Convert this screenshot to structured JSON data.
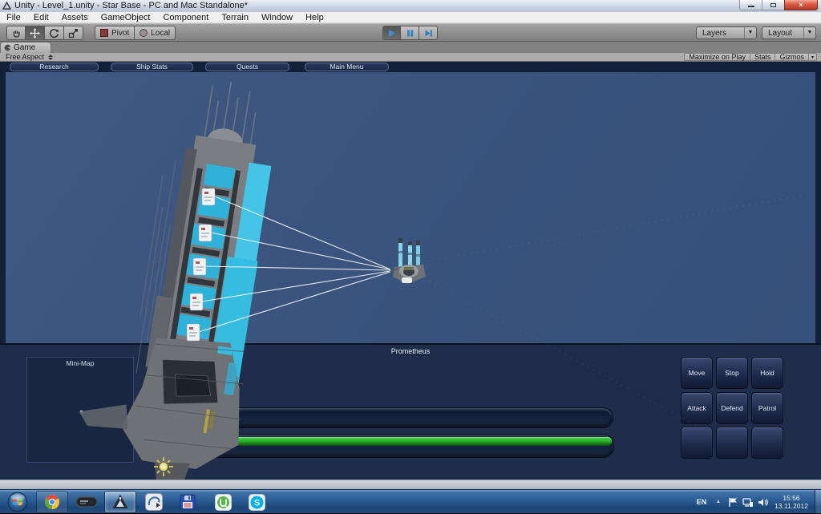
{
  "window": {
    "title": "Unity - Level_1.unity - Star Base - PC and Mac Standalone*"
  },
  "menu_bar": {
    "items": [
      "File",
      "Edit",
      "Assets",
      "GameObject",
      "Component",
      "Terrain",
      "Window",
      "Help"
    ]
  },
  "toolbar": {
    "pivot_label": "Pivot",
    "local_label": "Local",
    "layers_label": "Layers",
    "layout_label": "Layout"
  },
  "game_panel": {
    "tab_label": "Game",
    "aspect_value": "Free Aspect",
    "maximize_on_play_label": "Maximize on Play",
    "stats_label": "Stats",
    "gizmos_label": "Gizmos"
  },
  "game_ui": {
    "top_buttons": [
      "Research",
      "Ship Stats",
      "Quests",
      "Main Menu"
    ],
    "selected_unit_name": "Prometheus",
    "minimap_label": "Mini-Map",
    "command_buttons": [
      "Move",
      "Stop",
      "Hold",
      "Attack",
      "Defend",
      "Patrol"
    ],
    "health_bar": {
      "fill_percent": 0
    },
    "energy_bar": {
      "fill_percent": 99,
      "fill_color": "#2DB32D"
    }
  },
  "taskbar": {
    "language_indicator": "EN",
    "clock_time": "15:56",
    "clock_date": "13.11.2012"
  },
  "colors": {
    "scene_background": "#3A547E",
    "hud_panel": "#1F2D4B",
    "hud_dark": "#13203A",
    "accent_cyan": "#3FC2E4",
    "energy_green": "#2DB32D"
  }
}
